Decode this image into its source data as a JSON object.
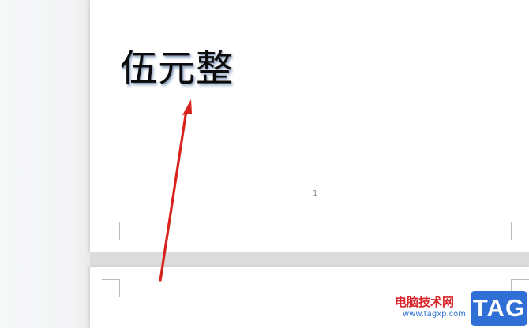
{
  "document": {
    "page1": {
      "text": "伍元整",
      "page_number": "1"
    }
  },
  "annotation": {
    "arrow_color": "#d9221c"
  },
  "watermark": {
    "site_name": "电脑技术网",
    "url": "www.tagxp.com",
    "tag": "TAG",
    "tag_color": "#2f6fd6"
  }
}
